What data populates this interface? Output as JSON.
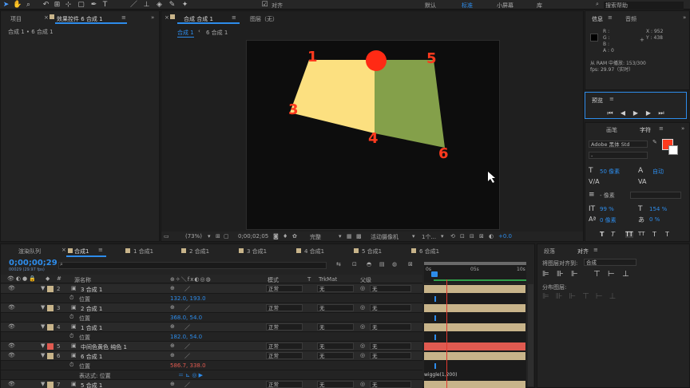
{
  "topbar": {
    "workspace_items": [
      "对齐",
      "默认",
      "标准",
      "小屏幕",
      "库"
    ],
    "search_placeholder": "搜索帮助"
  },
  "left_panel": {
    "tab_project": "项目",
    "tab_effects": "效果控件 6 合成 1",
    "breadcrumb": "合成 1 • 6 合成 1"
  },
  "viewer": {
    "tab_comp": "合成 合成 1",
    "tab_layer": "图层（无）",
    "crumb_1": "合成 1",
    "crumb_2": "6 合成 1",
    "labels": [
      "1",
      "5",
      "3",
      "4",
      "6"
    ],
    "colors": {
      "yellow": "#fce080",
      "green": "#84a04a",
      "dot": "#ff2a14",
      "label": "#ff3a1e"
    }
  },
  "viewer_footer": {
    "zoom": "(73%)",
    "timecode": "0;00;02;05",
    "resolution": "完整",
    "camera": "活动摄像机",
    "views": "1个...",
    "exposure": "+0.0"
  },
  "info_panel": {
    "tab_info": "信息",
    "tab_audio": "音频",
    "r": "R :",
    "g": "G :",
    "b": "B :",
    "a": "A : 0",
    "x": "X : 952",
    "y": "Y : 438",
    "ram": "从 RAM 中播放: 153/300",
    "fps": "fps: 29.97（实时）"
  },
  "preview_panel": {
    "title": "预览"
  },
  "char_panel": {
    "tab_brush": "画笔",
    "tab_char": "字符",
    "font": "Adobe 黑体 Std",
    "style": "-",
    "size": "50 像素",
    "leading": "自动",
    "kerning": "- 像素",
    "vscale": "99 %",
    "hscale": "154 %",
    "baseline": "0 像素",
    "tsume": "0 %",
    "styles": [
      "T",
      "T",
      "TT",
      "TT",
      "T",
      "T"
    ],
    "fill_color": "#ff3a1e"
  },
  "align_panel": {
    "tab_para": "段落",
    "tab_align": "对齐",
    "align_to_label": "将图层对齐到:",
    "align_to_value": "合成",
    "distribute": "分布图层:"
  },
  "timeline": {
    "tabs": [
      "渲染队列",
      "合成1",
      "1 合成1",
      "2 合成1",
      "3 合成1",
      "4 合成1",
      "5 合成1",
      "6 合成1"
    ],
    "timecode": "0;00;00;29",
    "fps_note": "00029 (29.97 fps)",
    "col_name": "源名称",
    "col_mode": "模式",
    "col_t": "T",
    "col_trkmat": "TrkMat",
    "col_parent": "父级",
    "ruler": [
      "0s",
      "05s",
      "10s"
    ],
    "expr_label": "表达式: 位置",
    "expr_text": "wiggle(1,200)",
    "rows": [
      {
        "kind": "layer",
        "num": "2",
        "name": "3 合成 1",
        "mode": "正常",
        "trk": "无",
        "parent": "无",
        "color": "#c8b48a"
      },
      {
        "kind": "prop",
        "name": "位置",
        "value": "132.0, 193.0"
      },
      {
        "kind": "layer",
        "num": "3",
        "name": "2 合成 1",
        "mode": "正常",
        "trk": "无",
        "parent": "无",
        "color": "#c8b48a"
      },
      {
        "kind": "prop",
        "name": "位置",
        "value": "368.0, 54.0"
      },
      {
        "kind": "layer",
        "num": "4",
        "name": "1 合成 1",
        "mode": "正常",
        "trk": "无",
        "parent": "无",
        "color": "#c8b48a"
      },
      {
        "kind": "prop",
        "name": "位置",
        "value": "182.0, 54.0"
      },
      {
        "kind": "layer",
        "num": "5",
        "name": "中间色黄色 纯色 1",
        "mode": "正常",
        "trk": "无",
        "parent": "无",
        "color": "#e05a50"
      },
      {
        "kind": "layer",
        "num": "6",
        "name": "6 合成 1",
        "mode": "正常",
        "trk": "无",
        "parent": "无",
        "color": "#c8b48a"
      },
      {
        "kind": "prop",
        "name": "位置",
        "value": "586.7, 338.0",
        "red": true
      },
      {
        "kind": "expr"
      },
      {
        "kind": "layer",
        "num": "7",
        "name": "5 合成 1",
        "mode": "正常",
        "trk": "无",
        "parent": "无",
        "color": "#c8b48a"
      }
    ]
  }
}
